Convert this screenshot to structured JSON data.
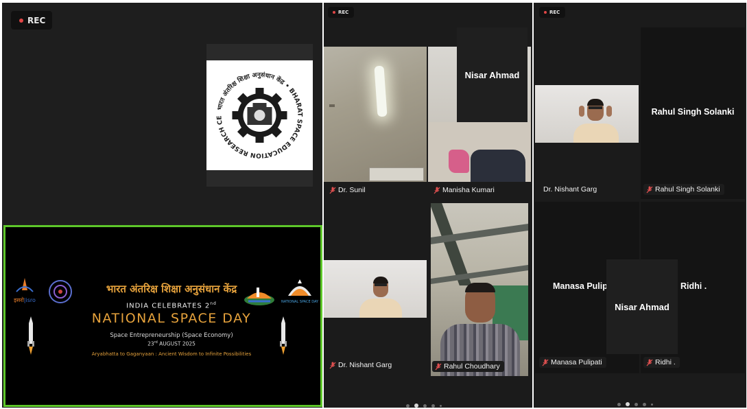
{
  "rec": {
    "label": "REC"
  },
  "banner": {
    "org_hindi": "भारत अंतरिक्ष शिक्षा अनुसंधान केंद्र",
    "celebrates": "INDIA CELEBRATES 2",
    "celebrates_sup": "nd",
    "title": "NATIONAL SPACE DAY",
    "theme": "Space Entrepreneurship (Space Economy)",
    "date_day": "23",
    "date_sup": "rd",
    "date_rest": "AUGUST 2025",
    "tagline": "Aryabhatta to Gaganyaan : Ancient Wisdom to Infinite Possibilities",
    "isro_hindi": "इसरो",
    "isro_latin": "isro",
    "nsd_logo_text": "NATIONAL SPACE DAY",
    "accent_color": "#e6a23c",
    "border_color": "#5ec72a"
  },
  "logo": {
    "ring_text": "भारत अंतरिक्ष शिक्षा अनुसंधान केंद्र • BHARAT SPACE EDUCATION RESEARCH CENTRE •"
  },
  "gallery_middle": {
    "overlay_name": "Nisar Ahmad",
    "tiles": [
      {
        "name": "Dr. Sunil",
        "muted": true
      },
      {
        "name": "Manisha Kumari",
        "muted": true
      },
      {
        "name": "Dr. Nishant Garg",
        "muted": true
      },
      {
        "name": "Rahul Choudhary",
        "muted": true
      }
    ]
  },
  "gallery_right": {
    "overlay_name": "Nisar Ahmad",
    "tiles": [
      {
        "name": "Dr. Nishant Garg",
        "muted": false,
        "big_name": ""
      },
      {
        "name": "Rahul Singh Solanki",
        "muted": true,
        "big_name": "Rahul Singh Solanki"
      },
      {
        "name": "Manasa Pulipati",
        "muted": true,
        "big_name": "Manasa Pulipati"
      },
      {
        "name": "Ridhi .",
        "muted": true,
        "big_name": "Ridhi ."
      }
    ]
  }
}
